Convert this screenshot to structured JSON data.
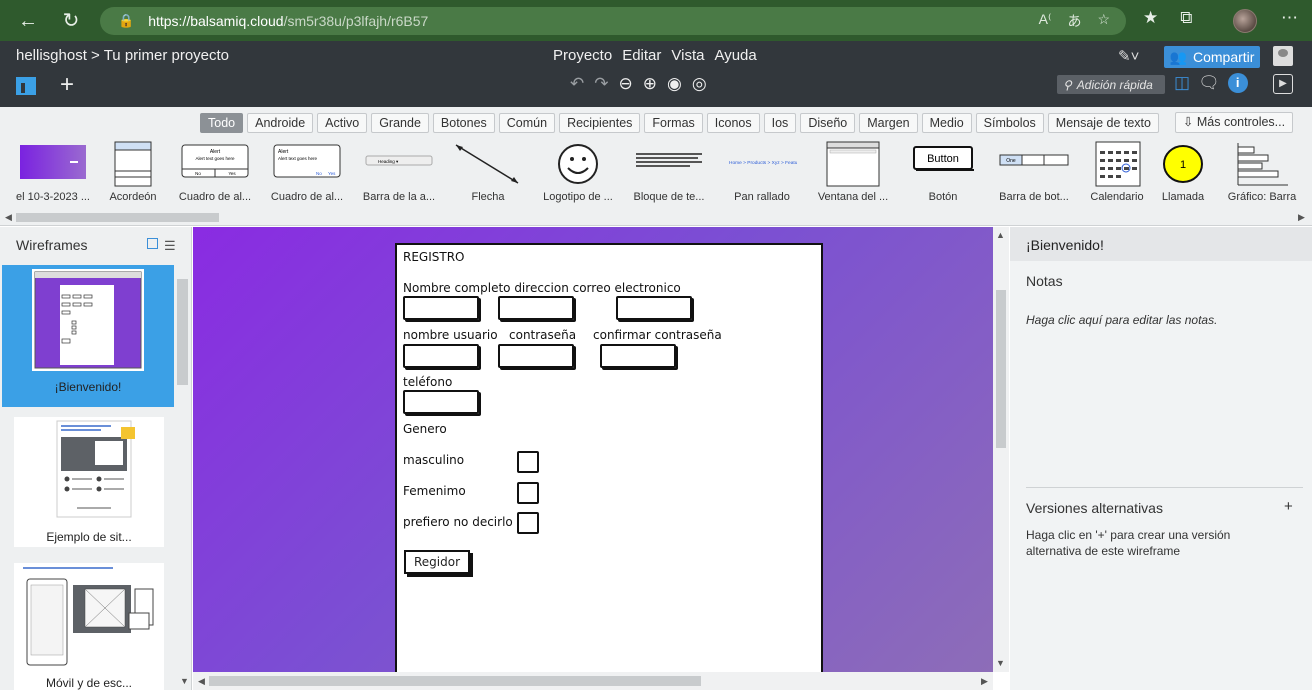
{
  "browser": {
    "url_host": "https://balsamiq.cloud",
    "url_path": "/sm5r38u/p3lfajh/r6B57"
  },
  "header": {
    "breadcrumb": "hellisghost > Tu primer proyecto",
    "menu": [
      "Proyecto",
      "Editar",
      "Vista",
      "Ayuda"
    ],
    "share_label": "Compartir",
    "quick_add_placeholder": "Adición rápida"
  },
  "library": {
    "filters": [
      "Todo",
      "Androide",
      "Activo",
      "Grande",
      "Botones",
      "Común",
      "Recipientes",
      "Formas",
      "Iconos",
      "Ios",
      "Diseño",
      "Margen",
      "Medio",
      "Símbolos",
      "Mensaje de texto"
    ],
    "active_filter": "Todo",
    "more_controls": "Más controles...",
    "items": [
      {
        "label": "el 10-3-2023 ...",
        "icon": "image-thumb"
      },
      {
        "label": "Acordeón",
        "icon": "accordion"
      },
      {
        "label": "Cuadro de al...",
        "icon": "alert-box",
        "title": "Alert",
        "text": "Alert text goes here",
        "b1": "No",
        "b2": "Yes"
      },
      {
        "label": "Cuadro de al...",
        "icon": "alert-box-2",
        "title": "Alert",
        "text": "Alert text goes here",
        "b1": "No",
        "b2": "Yes"
      },
      {
        "label": "Barra de la a...",
        "icon": "address-bar",
        "text": "Heading"
      },
      {
        "label": "Flecha",
        "icon": "arrow"
      },
      {
        "label": "Logotipo de ...",
        "icon": "smiley"
      },
      {
        "label": "Bloque de te...",
        "icon": "text-block"
      },
      {
        "label": "Pan rallado",
        "icon": "breadcrumb",
        "text": "Home > Products > Xyz > Features"
      },
      {
        "label": "Ventana del ...",
        "icon": "browser-window"
      },
      {
        "label": "Botón",
        "icon": "button",
        "text": "Button"
      },
      {
        "label": "Barra de bot...",
        "icon": "button-bar",
        "b": [
          "One",
          "Two",
          "Three"
        ]
      },
      {
        "label": "Calendario",
        "icon": "calendar"
      },
      {
        "label": "Llamada",
        "icon": "callout",
        "text": "1"
      },
      {
        "label": "Gráfico: Barra",
        "icon": "bar-chart"
      }
    ]
  },
  "wireframes": {
    "title": "Wireframes",
    "items": [
      {
        "label": "¡Bienvenido!",
        "selected": true
      },
      {
        "label": "Ejemplo de sit..."
      },
      {
        "label": "Móvil y de esc..."
      }
    ]
  },
  "form": {
    "title": "REGISTRO",
    "row1_label": "Nombre completo direccion correo electronico",
    "user_label": "nombre usuario",
    "pass_label": "contraseña",
    "confirm_label": "confirmar contraseña",
    "phone_label": "teléfono",
    "gender_label": "Genero",
    "opt_male": "masculino",
    "opt_female": "Femenimo",
    "opt_none": "prefiero no decirlo",
    "submit_label": "Regidor"
  },
  "notes_panel": {
    "title": "¡Bienvenido!",
    "notes_heading": "Notas",
    "notes_hint": "Haga clic aquí para editar las notas.",
    "alt_heading": "Versiones alternativas",
    "alt_plus": "+",
    "alt_hint": "Haga clic en '+' para crear una versión alternativa de este wireframe"
  },
  "colors": {
    "browser_bar": "#2f5a2d",
    "app_header": "#32373c",
    "accent": "#3b8fd8",
    "canvas_gradient_start": "#8a2be2"
  }
}
